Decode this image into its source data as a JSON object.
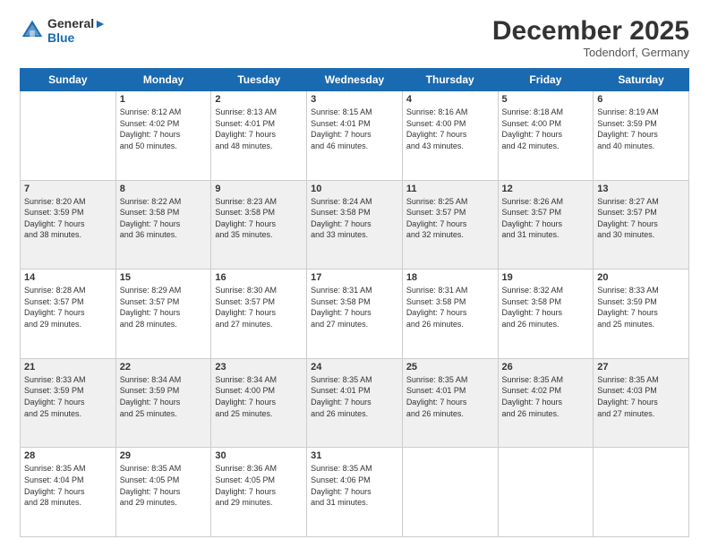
{
  "header": {
    "logo_line1": "General",
    "logo_line2": "Blue",
    "month": "December 2025",
    "location": "Todendorf, Germany"
  },
  "weekdays": [
    "Sunday",
    "Monday",
    "Tuesday",
    "Wednesday",
    "Thursday",
    "Friday",
    "Saturday"
  ],
  "weeks": [
    [
      {
        "day": "",
        "info": ""
      },
      {
        "day": "1",
        "info": "Sunrise: 8:12 AM\nSunset: 4:02 PM\nDaylight: 7 hours\nand 50 minutes."
      },
      {
        "day": "2",
        "info": "Sunrise: 8:13 AM\nSunset: 4:01 PM\nDaylight: 7 hours\nand 48 minutes."
      },
      {
        "day": "3",
        "info": "Sunrise: 8:15 AM\nSunset: 4:01 PM\nDaylight: 7 hours\nand 46 minutes."
      },
      {
        "day": "4",
        "info": "Sunrise: 8:16 AM\nSunset: 4:00 PM\nDaylight: 7 hours\nand 43 minutes."
      },
      {
        "day": "5",
        "info": "Sunrise: 8:18 AM\nSunset: 4:00 PM\nDaylight: 7 hours\nand 42 minutes."
      },
      {
        "day": "6",
        "info": "Sunrise: 8:19 AM\nSunset: 3:59 PM\nDaylight: 7 hours\nand 40 minutes."
      }
    ],
    [
      {
        "day": "7",
        "info": "Sunrise: 8:20 AM\nSunset: 3:59 PM\nDaylight: 7 hours\nand 38 minutes."
      },
      {
        "day": "8",
        "info": "Sunrise: 8:22 AM\nSunset: 3:58 PM\nDaylight: 7 hours\nand 36 minutes."
      },
      {
        "day": "9",
        "info": "Sunrise: 8:23 AM\nSunset: 3:58 PM\nDaylight: 7 hours\nand 35 minutes."
      },
      {
        "day": "10",
        "info": "Sunrise: 8:24 AM\nSunset: 3:58 PM\nDaylight: 7 hours\nand 33 minutes."
      },
      {
        "day": "11",
        "info": "Sunrise: 8:25 AM\nSunset: 3:57 PM\nDaylight: 7 hours\nand 32 minutes."
      },
      {
        "day": "12",
        "info": "Sunrise: 8:26 AM\nSunset: 3:57 PM\nDaylight: 7 hours\nand 31 minutes."
      },
      {
        "day": "13",
        "info": "Sunrise: 8:27 AM\nSunset: 3:57 PM\nDaylight: 7 hours\nand 30 minutes."
      }
    ],
    [
      {
        "day": "14",
        "info": "Sunrise: 8:28 AM\nSunset: 3:57 PM\nDaylight: 7 hours\nand 29 minutes."
      },
      {
        "day": "15",
        "info": "Sunrise: 8:29 AM\nSunset: 3:57 PM\nDaylight: 7 hours\nand 28 minutes."
      },
      {
        "day": "16",
        "info": "Sunrise: 8:30 AM\nSunset: 3:57 PM\nDaylight: 7 hours\nand 27 minutes."
      },
      {
        "day": "17",
        "info": "Sunrise: 8:31 AM\nSunset: 3:58 PM\nDaylight: 7 hours\nand 27 minutes."
      },
      {
        "day": "18",
        "info": "Sunrise: 8:31 AM\nSunset: 3:58 PM\nDaylight: 7 hours\nand 26 minutes."
      },
      {
        "day": "19",
        "info": "Sunrise: 8:32 AM\nSunset: 3:58 PM\nDaylight: 7 hours\nand 26 minutes."
      },
      {
        "day": "20",
        "info": "Sunrise: 8:33 AM\nSunset: 3:59 PM\nDaylight: 7 hours\nand 25 minutes."
      }
    ],
    [
      {
        "day": "21",
        "info": "Sunrise: 8:33 AM\nSunset: 3:59 PM\nDaylight: 7 hours\nand 25 minutes."
      },
      {
        "day": "22",
        "info": "Sunrise: 8:34 AM\nSunset: 3:59 PM\nDaylight: 7 hours\nand 25 minutes."
      },
      {
        "day": "23",
        "info": "Sunrise: 8:34 AM\nSunset: 4:00 PM\nDaylight: 7 hours\nand 25 minutes."
      },
      {
        "day": "24",
        "info": "Sunrise: 8:35 AM\nSunset: 4:01 PM\nDaylight: 7 hours\nand 26 minutes."
      },
      {
        "day": "25",
        "info": "Sunrise: 8:35 AM\nSunset: 4:01 PM\nDaylight: 7 hours\nand 26 minutes."
      },
      {
        "day": "26",
        "info": "Sunrise: 8:35 AM\nSunset: 4:02 PM\nDaylight: 7 hours\nand 26 minutes."
      },
      {
        "day": "27",
        "info": "Sunrise: 8:35 AM\nSunset: 4:03 PM\nDaylight: 7 hours\nand 27 minutes."
      }
    ],
    [
      {
        "day": "28",
        "info": "Sunrise: 8:35 AM\nSunset: 4:04 PM\nDaylight: 7 hours\nand 28 minutes."
      },
      {
        "day": "29",
        "info": "Sunrise: 8:35 AM\nSunset: 4:05 PM\nDaylight: 7 hours\nand 29 minutes."
      },
      {
        "day": "30",
        "info": "Sunrise: 8:36 AM\nSunset: 4:05 PM\nDaylight: 7 hours\nand 29 minutes."
      },
      {
        "day": "31",
        "info": "Sunrise: 8:35 AM\nSunset: 4:06 PM\nDaylight: 7 hours\nand 31 minutes."
      },
      {
        "day": "",
        "info": ""
      },
      {
        "day": "",
        "info": ""
      },
      {
        "day": "",
        "info": ""
      }
    ]
  ]
}
